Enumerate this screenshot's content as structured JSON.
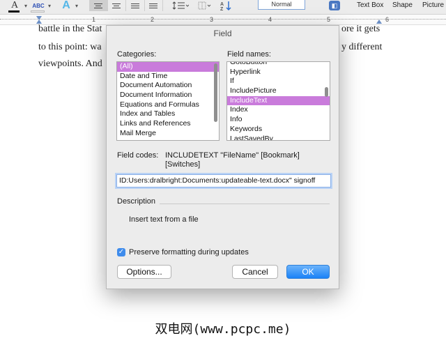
{
  "toolbar": {
    "style_name": "Normal",
    "labels": [
      "Text Box",
      "Shape",
      "Picture"
    ]
  },
  "ruler": {
    "numbers": [
      "1",
      "2",
      "3",
      "4",
      "5",
      "6"
    ]
  },
  "document": {
    "lines": [
      "battle in the Stat",
      "ore it gets",
      "to this point: wa",
      "y different",
      "viewpoints. And"
    ]
  },
  "dialog": {
    "title": "Field",
    "categories_label": "Categories:",
    "categories": [
      "(All)",
      "Date and Time",
      "Document Automation",
      "Document Information",
      "Equations and Formulas",
      "Index and Tables",
      "Links and References",
      "Mail Merge"
    ],
    "field_names_label": "Field names:",
    "field_names": [
      "GotoButton",
      "Hyperlink",
      "If",
      "IncludePicture",
      "IncludeText",
      "Index",
      "Info",
      "Keywords",
      "LastSavedBy"
    ],
    "field_codes_label": "Field codes:",
    "field_codes_syntax": "INCLUDETEXT \"FileName\" [Bookmark] [Switches]",
    "field_codes_value": "ID:Users:dralbright:Documents:updateable-text.docx\" signoff",
    "description_label": "Description",
    "description_text": "Insert text from a file",
    "preserve_label": "Preserve formatting during updates",
    "preserve_checked": true,
    "options_button": "Options...",
    "cancel_button": "Cancel",
    "ok_button": "OK"
  },
  "watermark": "双电网(www.pcpc.me)",
  "colors": {
    "selection": "#c97bdb",
    "accent": "#1a82f7"
  }
}
